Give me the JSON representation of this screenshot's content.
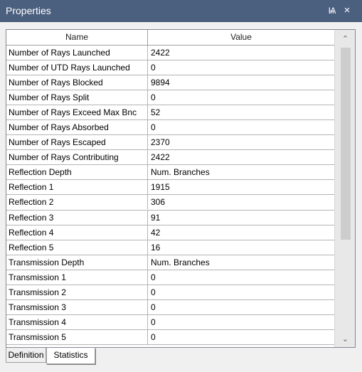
{
  "window": {
    "title": "Properties",
    "pin_glyph": "Ѩ",
    "close_glyph": "×"
  },
  "icons": {
    "pin": "pin-icon",
    "close": "close-icon",
    "scroll_up": "chevron-up-icon",
    "scroll_down": "chevron-down-icon"
  },
  "grid": {
    "columns": [
      "Name",
      "Value"
    ],
    "rows": [
      {
        "name": "Number of Rays Launched",
        "value": "2422"
      },
      {
        "name": "Number of UTD Rays Launched",
        "value": "0"
      },
      {
        "name": "Number of Rays Blocked",
        "value": "9894"
      },
      {
        "name": "Number of Rays Split",
        "value": "0"
      },
      {
        "name": "Number of Rays Exceed Max Bnc",
        "value": "52"
      },
      {
        "name": "Number of Rays Absorbed",
        "value": "0"
      },
      {
        "name": "Number of Rays Escaped",
        "value": "2370"
      },
      {
        "name": "Number of Rays Contributing",
        "value": "2422"
      },
      {
        "name": "Reflection Depth",
        "value": "Num. Branches"
      },
      {
        "name": "Reflection 1",
        "value": "1915"
      },
      {
        "name": "Reflection 2",
        "value": "306"
      },
      {
        "name": "Reflection 3",
        "value": "91"
      },
      {
        "name": "Reflection 4",
        "value": "42"
      },
      {
        "name": "Reflection 5",
        "value": "16"
      },
      {
        "name": "Transmission Depth",
        "value": "Num. Branches"
      },
      {
        "name": "Transmission 1",
        "value": "0"
      },
      {
        "name": "Transmission 2",
        "value": "0"
      },
      {
        "name": "Transmission 3",
        "value": "0"
      },
      {
        "name": "Transmission 4",
        "value": "0"
      },
      {
        "name": "Transmission 5",
        "value": "0"
      }
    ]
  },
  "tabs": [
    {
      "label": "Definition",
      "selected": false
    },
    {
      "label": "Statistics",
      "selected": true
    }
  ],
  "colors": {
    "titlebar": "#4b5f7f",
    "title_text": "#ffffff",
    "grid_line": "#b4b4b4"
  }
}
